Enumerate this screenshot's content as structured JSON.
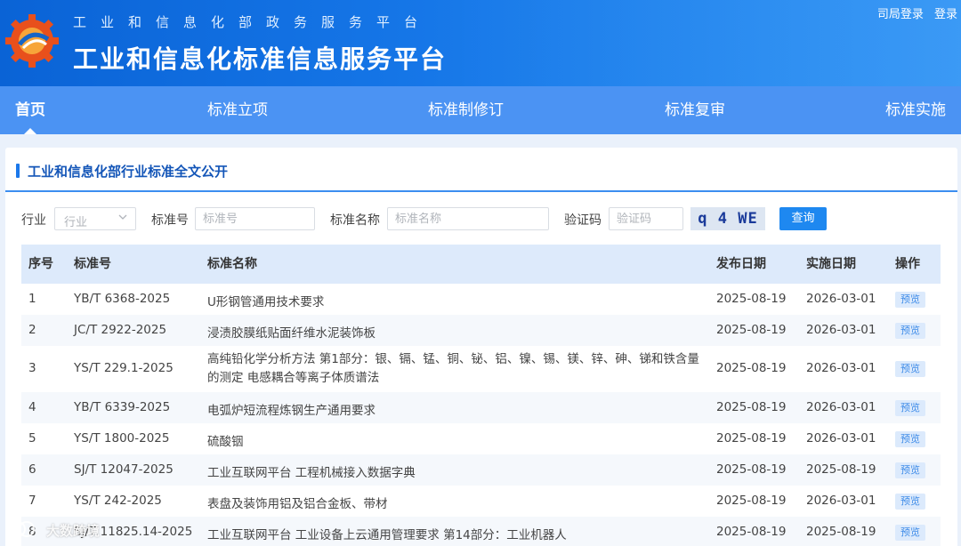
{
  "header": {
    "subtitle": "工业和信息化部政务服务平台",
    "title": "工业和信息化标准信息服务平台",
    "links": [
      "司局登录",
      "登录"
    ]
  },
  "nav": {
    "items": [
      "首页",
      "标准立项",
      "标准制修订",
      "标准复审",
      "标准实施"
    ],
    "active": "首页"
  },
  "section": {
    "title": "工业和信息化部行业标准全文公开"
  },
  "search": {
    "industry_label": "行业",
    "industry_placeholder": "行业",
    "std_no_label": "标准号",
    "std_no_placeholder": "标准号",
    "std_name_label": "标准名称",
    "std_name_placeholder": "标准名称",
    "captcha_label": "验证码",
    "captcha_placeholder": "验证码",
    "captcha_text": "q 4 WE",
    "query_button": "查询"
  },
  "table": {
    "columns": [
      "序号",
      "标准号",
      "标准名称",
      "发布日期",
      "实施日期",
      "操作"
    ],
    "preview_label": "预览",
    "rows": [
      {
        "no": "1",
        "code": "YB/T 6368-2025",
        "name": "U形钢管通用技术要求",
        "pub": "2025-08-19",
        "impl": "2026-03-01"
      },
      {
        "no": "2",
        "code": "JC/T 2922-2025",
        "name": "浸渍胶膜纸贴面纤维水泥装饰板",
        "pub": "2025-08-19",
        "impl": "2026-03-01"
      },
      {
        "no": "3",
        "code": "YS/T 229.1-2025",
        "name": "高纯铅化学分析方法 第1部分：银、镉、锰、铜、铋、铝、镍、锡、镁、锌、砷、锑和铁含量的测定 电感耦合等离子体质谱法",
        "pub": "2025-08-19",
        "impl": "2026-03-01"
      },
      {
        "no": "4",
        "code": "YB/T 6339-2025",
        "name": "电弧炉短流程炼钢生产通用要求",
        "pub": "2025-08-19",
        "impl": "2026-03-01"
      },
      {
        "no": "5",
        "code": "YS/T 1800-2025",
        "name": "硫酸铟",
        "pub": "2025-08-19",
        "impl": "2026-03-01"
      },
      {
        "no": "6",
        "code": "SJ/T 12047-2025",
        "name": "工业互联网平台 工程机械接入数据字典",
        "pub": "2025-08-19",
        "impl": "2025-08-19"
      },
      {
        "no": "7",
        "code": "YS/T 242-2025",
        "name": "表盘及装饰用铝及铝合金板、带材",
        "pub": "2025-08-19",
        "impl": "2026-03-01"
      },
      {
        "no": "8",
        "code": "SJ/T 11825.14-2025",
        "name": "工业互联网平台 工业设备上云通用管理要求 第14部分：工业机器人",
        "pub": "2025-08-19",
        "impl": "2025-08-19"
      }
    ]
  },
  "watermark": "大数跨境",
  "colors": {
    "header_blue": "#1677e8",
    "nav_blue": "#4b93f3",
    "accent": "#1e88f0",
    "table_head": "#ddeafb"
  }
}
